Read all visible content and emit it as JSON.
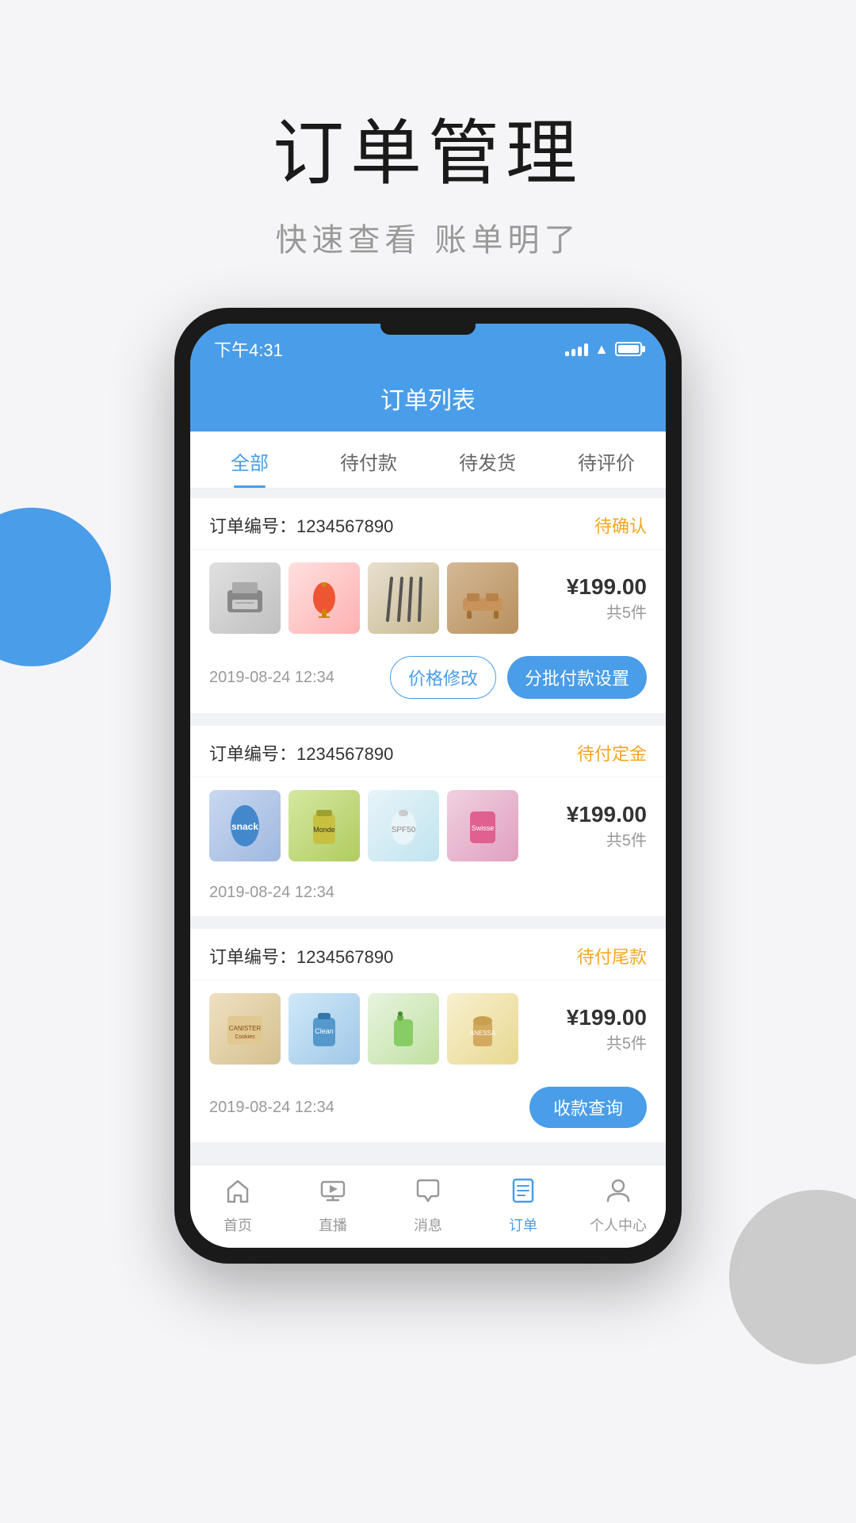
{
  "hero": {
    "title": "订单管理",
    "subtitle": "快速查看  账单明了"
  },
  "app": {
    "status_time": "下午4:31",
    "header_title": "订单列表",
    "tabs": [
      {
        "label": "全部",
        "active": true
      },
      {
        "label": "待付款",
        "active": false
      },
      {
        "label": "待发货",
        "active": false
      },
      {
        "label": "待评价",
        "active": false
      }
    ],
    "orders": [
      {
        "id": "order-1",
        "number_label": "订单编号：1234567890",
        "status": "待确认",
        "status_class": "status-confirm",
        "price": "¥199.00",
        "count": "共5件",
        "date": "2019-08-24 12:34",
        "actions": [
          {
            "label": "价格修改",
            "type": "outline"
          },
          {
            "label": "分批付款设置",
            "type": "filled"
          }
        ],
        "products": [
          "img-printer",
          "img-lantern",
          "img-chopsticks",
          "img-furniture"
        ]
      },
      {
        "id": "order-2",
        "number_label": "订单编号：1234567890",
        "status": "待付定金",
        "status_class": "status-deposit",
        "price": "¥199.00",
        "count": "共5件",
        "date": "2019-08-24 12:34",
        "actions": [],
        "products": [
          "img-snack",
          "img-sauce",
          "img-sunscreen",
          "img-medicine"
        ]
      },
      {
        "id": "order-3",
        "number_label": "订单编号：1234567890",
        "status": "待付尾款",
        "status_class": "status-final",
        "price": "¥199.00",
        "count": "共5件",
        "date": "2019-08-24 12:34",
        "actions": [
          {
            "label": "收款查询",
            "type": "query"
          }
        ],
        "products": [
          "img-biscuit",
          "img-cleaning",
          "img-lotion",
          "img-cosmetic"
        ]
      }
    ],
    "nav": [
      {
        "label": "首页",
        "icon": "🏠",
        "active": false
      },
      {
        "label": "直播",
        "icon": "📺",
        "active": false
      },
      {
        "label": "消息",
        "icon": "💬",
        "active": false
      },
      {
        "label": "订单",
        "icon": "📋",
        "active": true
      },
      {
        "label": "个人中心",
        "icon": "👤",
        "active": false
      }
    ]
  }
}
